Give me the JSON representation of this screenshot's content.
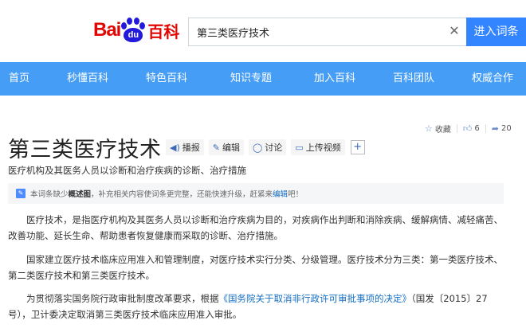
{
  "header": {
    "logo_text_1": "Bai",
    "logo_text_2": "du",
    "logo_text_3": "百科",
    "search_value": "第三类医疗技术",
    "clear_glyph": "✕",
    "search_button_label": "进入词条"
  },
  "nav": {
    "items": [
      {
        "label": "首页"
      },
      {
        "label": "秒懂百科"
      },
      {
        "label": "特色百科"
      },
      {
        "label": "知识专题"
      },
      {
        "label": "加入百科"
      },
      {
        "label": "百科团队"
      },
      {
        "label": "权威合作"
      }
    ]
  },
  "top_right": {
    "collect_label": "收藏",
    "like_count": "6",
    "share_count": "20"
  },
  "title": {
    "text": "第三类医疗技术",
    "actions": [
      {
        "label": "播报",
        "icon": "speaker-icon"
      },
      {
        "label": "编辑",
        "icon": "edit-icon"
      },
      {
        "label": "讨论",
        "icon": "comment-icon"
      },
      {
        "label": "上传视频",
        "icon": "video-icon"
      }
    ],
    "plus_glyph": "+"
  },
  "subtitle": "医疗机构及其医务人员以诊断和治疗疾病的诊断、治疗措施",
  "notice": {
    "prefix": "本词条缺少",
    "bold": "概述图",
    "middle": "，补充相关内容使词条更完整，还能快速升级，赶紧来",
    "link": "编辑",
    "suffix": "吧！"
  },
  "paragraphs": {
    "p1": "医疗技术，是指医疗机构及其医务人员以诊断和治疗疾病为目的，对疾病作出判断和消除疾病、缓解病情、减轻痛苦、改善功能、延长生命、帮助患者恢复健康而采取的诊断、治疗措施。",
    "p2": "国家建立医疗技术临床应用准入和管理制度，对医疗技术实行分类、分级管理。医疗技术分为三类：第一类医疗技术、第二类医疗技术和第三类医疗技术。",
    "p3_before": "为贯彻落实国务院行政审批制度改革要求，根据",
    "p3_link": "《国务院关于取消非行政许可审批事项的决定》",
    "p3_after": "（国发〔2015〕27号），卫计委决定取消第三类医疗技术临床应用准入审批。"
  },
  "colors": {
    "nav_bg": "#459df5",
    "search_button_bg": "#3385ff",
    "logo_red": "#e10602",
    "logo_blue": "#2319dc",
    "link": "#136ec2"
  }
}
